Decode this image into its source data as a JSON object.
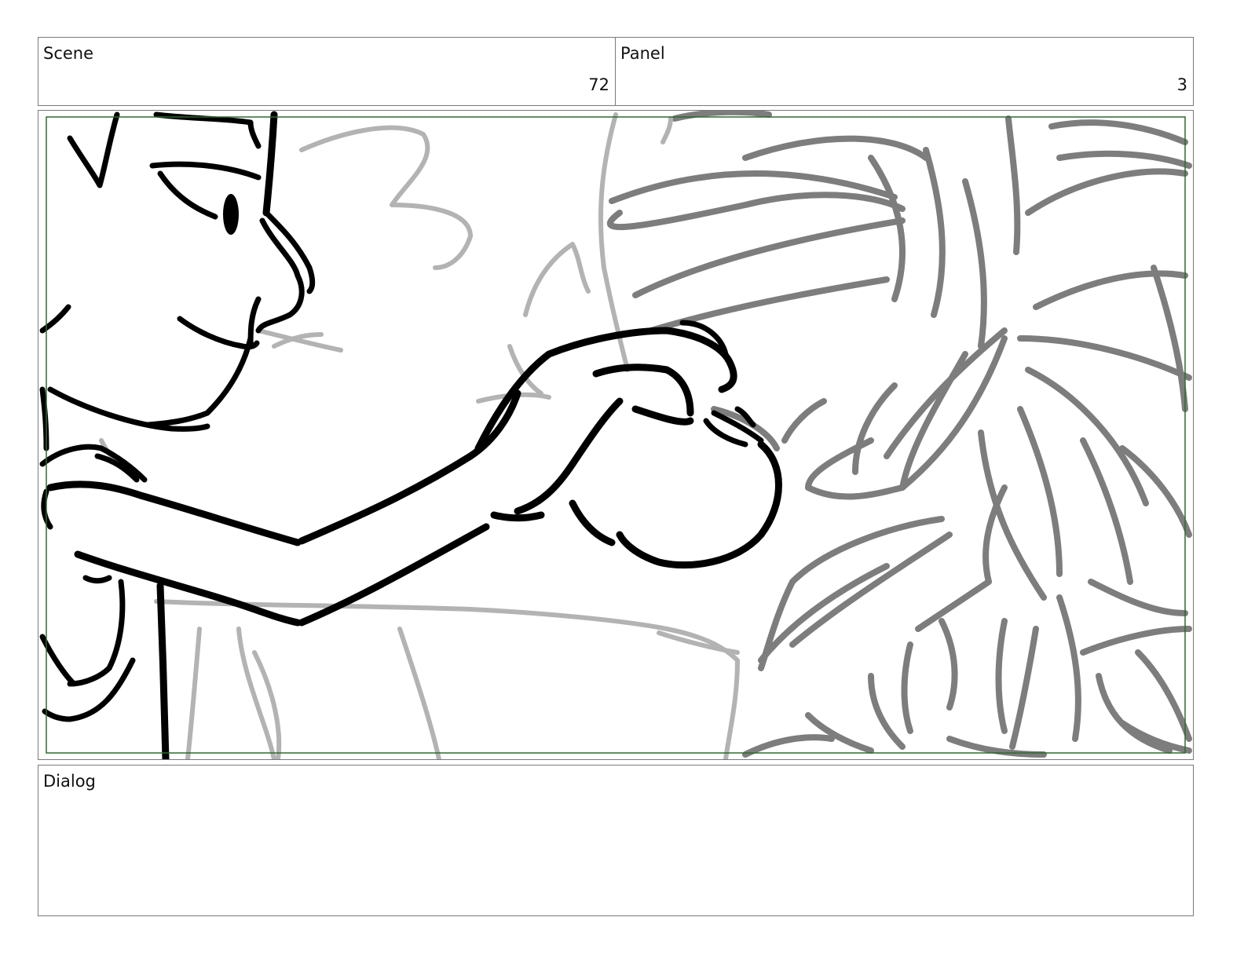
{
  "header": {
    "scene_label": "Scene",
    "scene_number": "72",
    "panel_label": "Panel",
    "panel_number": "3"
  },
  "dialog": {
    "label": "Dialog",
    "text": ""
  },
  "frame": {
    "safe_area_color": "#2e6b2e",
    "ink_color": "#000000",
    "background_sketch_color": "#7d7d7d",
    "light_sketch_color": "#b3b3b3"
  }
}
